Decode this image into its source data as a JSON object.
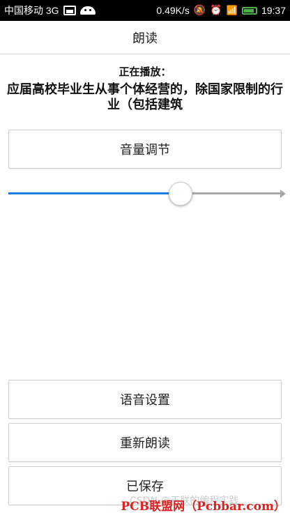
{
  "status_bar": {
    "carrier": "中国移动 3G",
    "speed": "0.49K/s",
    "time": "19:37"
  },
  "app_bar": {
    "title": "朗读"
  },
  "now_playing": {
    "label": "正在播放：",
    "title": "应届高校毕业生从事个体经营的，除国家限制的行业（包括建筑"
  },
  "buttons": {
    "volume": "音量调节",
    "voice_settings": "语音设置",
    "reread": "重新朗读",
    "saved": "已保存"
  },
  "volume_slider": {
    "value_fraction": 0.63
  },
  "colors": {
    "accent": "#1e7be0",
    "track": "#a8a8a8",
    "watermark_red": "#e02020"
  },
  "watermarks": {
    "csdn": "CSDN @王朕的编程实践",
    "pcb": "PCB联盟网（Pcbbar.com）"
  }
}
